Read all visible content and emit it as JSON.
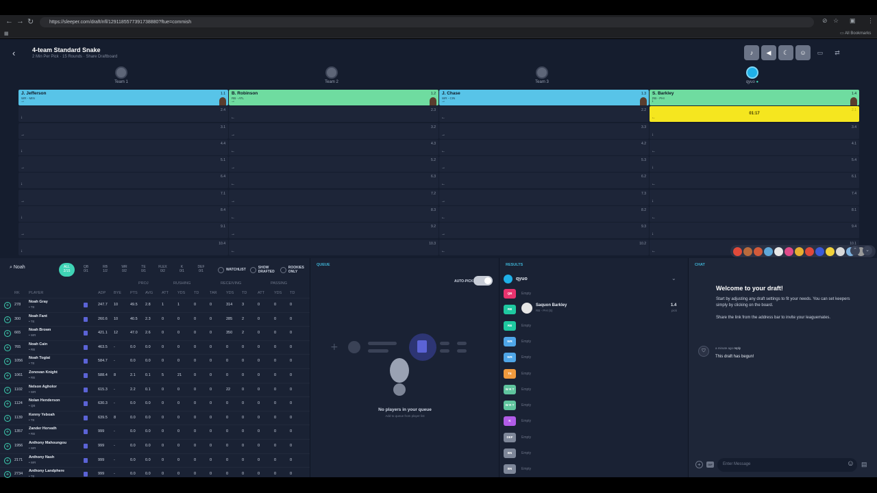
{
  "browser": {
    "url": "https://sleeper.com/draft/nfl/1291185577391738880?ftue=commish",
    "bookmarks_label": "All Bookmarks"
  },
  "header": {
    "title": "4-team Standard Snake",
    "subtitle": "2 Min Per Pick · 15 Rounds · Share Draftboard",
    "buttons": [
      "bell-icon",
      "speaker-icon",
      "moon-icon",
      "smiley-icon",
      "monitor-icon",
      "compress-icon"
    ]
  },
  "teams": [
    "Team 1",
    "Team 2",
    "Team 3",
    "qyuo"
  ],
  "columns": [
    {
      "first": {
        "name": "J. Jefferson",
        "pos": "WR - MIN",
        "pick": "1.1",
        "style": "wr"
      },
      "picks": [
        "2.4",
        "3.1",
        "4.4",
        "5.1",
        "6.4",
        "7.1",
        "8.4",
        "9.1",
        "10.4"
      ],
      "arrows": [
        "↓",
        "→",
        "↓",
        "→",
        "↓",
        "→",
        "↓",
        "→",
        "↓"
      ]
    },
    {
      "first": {
        "name": "B. Robinson",
        "pos": "RB - ATL",
        "pick": "1.2",
        "style": "rb"
      },
      "picks": [
        "2.3",
        "3.2",
        "4.3",
        "5.2",
        "6.3",
        "7.2",
        "8.3",
        "9.2",
        "10.3"
      ],
      "arrows": [
        "←",
        "→",
        "←",
        "→",
        "←",
        "→",
        "←",
        "→",
        "←"
      ]
    },
    {
      "first": {
        "name": "J. Chase",
        "pos": "WR - CIN",
        "pick": "1.3",
        "style": "wr"
      },
      "picks": [
        "2.2",
        "3.3",
        "4.2",
        "5.3",
        "6.2",
        "7.3",
        "8.2",
        "9.3",
        "10.2"
      ],
      "arrows": [
        "←",
        "→",
        "←",
        "→",
        "←",
        "→",
        "←",
        "→",
        "←"
      ]
    },
    {
      "first": {
        "name": "S. Barkley",
        "pos": "RB - PHI",
        "pick": "1.4",
        "style": "rb"
      },
      "clock": {
        "timer": "01:17",
        "pick": "2.1"
      },
      "picks": [
        "3.4",
        "4.1",
        "5.4",
        "6.1",
        "7.4",
        "8.1",
        "9.4",
        "10.1"
      ],
      "arrows": [
        "↓",
        "←",
        "↓",
        "←",
        "↓",
        "←",
        "↓",
        "←"
      ]
    }
  ],
  "players_panel": {
    "search_value": "Noah",
    "position_tabs": [
      {
        "label": "ALL",
        "count": "2/15",
        "active": true
      },
      {
        "label": "QB",
        "count": "0/1"
      },
      {
        "label": "RB",
        "count": "1/2"
      },
      {
        "label": "WR",
        "count": "0/2"
      },
      {
        "label": "TE",
        "count": "0/1"
      },
      {
        "label": "FLEX",
        "count": "0/2"
      },
      {
        "label": "K",
        "count": "0/1"
      },
      {
        "label": "DEF",
        "count": "0/1"
      }
    ],
    "filters": [
      "WATCHLIST",
      "SHOW DRAFTED",
      "ROOKIES ONLY"
    ],
    "group_headers": [
      "PROJ",
      "RUSHING",
      "RECEIVING",
      "PASSING"
    ],
    "columns": [
      "RK",
      "PLAYER",
      "ADP",
      "BYE",
      "PTS",
      "AVG",
      "ATT",
      "YDS",
      "TD",
      "TAR",
      "YDS",
      "TD",
      "ATT",
      "YDS",
      "TD"
    ],
    "rows": [
      {
        "rk": "278",
        "name": "Noah Gray",
        "pos": "• TE",
        "vals": [
          "247.7",
          "10",
          "49.5",
          "2.8",
          "1",
          "1",
          "0",
          "0",
          "314",
          "3",
          "0",
          "0",
          "0"
        ]
      },
      {
        "rk": "300",
        "name": "Noah Fant",
        "pos": "• TE",
        "vals": [
          "260.6",
          "10",
          "40.5",
          "2.3",
          "0",
          "0",
          "0",
          "0",
          "285",
          "2",
          "0",
          "0",
          "0"
        ]
      },
      {
        "rk": "665",
        "name": "Noah Brown",
        "pos": "• WR",
        "vals": [
          "421.1",
          "12",
          "47.0",
          "2.6",
          "0",
          "0",
          "0",
          "0",
          "350",
          "2",
          "0",
          "0",
          "0"
        ]
      },
      {
        "rk": "765",
        "name": "Noah Cain",
        "pos": "• RB",
        "vals": [
          "463.5",
          "-",
          "0.0",
          "0.0",
          "0",
          "0",
          "0",
          "0",
          "0",
          "0",
          "0",
          "0",
          "0"
        ]
      },
      {
        "rk": "1056",
        "name": "Noah Togiai",
        "pos": "• TE",
        "vals": [
          "584.7",
          "-",
          "0.0",
          "0.0",
          "0",
          "0",
          "0",
          "0",
          "0",
          "0",
          "0",
          "0",
          "0"
        ]
      },
      {
        "rk": "1061",
        "name": "Zonovan Knight",
        "pos": "• RB",
        "vals": [
          "588.4",
          "8",
          "2.1",
          "0.1",
          "5",
          "21",
          "0",
          "0",
          "0",
          "0",
          "0",
          "0",
          "0"
        ]
      },
      {
        "rk": "1102",
        "name": "Nelson Agholor",
        "pos": "• WR",
        "vals": [
          "615.3",
          "-",
          "2.2",
          "0.1",
          "0",
          "0",
          "0",
          "0",
          "22",
          "0",
          "0",
          "0",
          "0"
        ]
      },
      {
        "rk": "1124",
        "name": "Nolan Henderson",
        "pos": "• QB",
        "vals": [
          "630.3",
          "-",
          "0.0",
          "0.0",
          "0",
          "0",
          "0",
          "0",
          "0",
          "0",
          "0",
          "0",
          "0"
        ]
      },
      {
        "rk": "1139",
        "name": "Kenny Yeboah",
        "pos": "• TE",
        "vals": [
          "639.5",
          "8",
          "0.0",
          "0.0",
          "0",
          "0",
          "0",
          "0",
          "0",
          "0",
          "0",
          "0",
          "0"
        ]
      },
      {
        "rk": "1357",
        "name": "Zander Horvath",
        "pos": "• RB",
        "vals": [
          "999",
          "-",
          "0.0",
          "0.0",
          "0",
          "0",
          "0",
          "0",
          "0",
          "0",
          "0",
          "0",
          "0"
        ]
      },
      {
        "rk": "1956",
        "name": "Anthony Mahoungou",
        "pos": "• WR",
        "vals": [
          "999",
          "-",
          "0.0",
          "0.0",
          "0",
          "0",
          "0",
          "0",
          "0",
          "0",
          "0",
          "0",
          "0"
        ]
      },
      {
        "rk": "2171",
        "name": "Anthony Nash",
        "pos": "• WR",
        "vals": [
          "999",
          "-",
          "0.0",
          "0.0",
          "0",
          "0",
          "0",
          "0",
          "0",
          "0",
          "0",
          "0",
          "0"
        ]
      },
      {
        "rk": "2734",
        "name": "Anthony Landphere",
        "pos": "• TE",
        "vals": [
          "999",
          "-",
          "0.0",
          "0.0",
          "0",
          "0",
          "0",
          "0",
          "0",
          "0",
          "0",
          "0",
          "0"
        ]
      }
    ]
  },
  "queue": {
    "title": "QUEUE",
    "auto_pick_label": "AUTO-PICK",
    "empty_title": "No players in your queue",
    "empty_sub": "Add to queue from player list"
  },
  "results": {
    "title": "RESULTS",
    "user": "qyuo",
    "slots": [
      {
        "pos": "QB",
        "color": "#e8336e",
        "label": "Empty"
      },
      {
        "pos": "RB",
        "color": "#1fc9a0",
        "player": "Saquon Barkley",
        "sub": "RB - PHI (5)",
        "pick": "1.4",
        "pick_label": "pick"
      },
      {
        "pos": "RB",
        "color": "#1fc9a0",
        "label": "Empty"
      },
      {
        "pos": "WR",
        "color": "#4fa6e8",
        "label": "Empty"
      },
      {
        "pos": "WR",
        "color": "#4fa6e8",
        "label": "Empty"
      },
      {
        "pos": "TE",
        "color": "#f09a3e",
        "label": "Empty"
      },
      {
        "pos": "W R T",
        "color": "#5fc49e",
        "label": "Empty"
      },
      {
        "pos": "W R T",
        "color": "#5fc49e",
        "label": "Empty"
      },
      {
        "pos": "K",
        "color": "#b15ce8",
        "label": "Empty"
      },
      {
        "pos": "DEF",
        "color": "#7e8799",
        "label": "Empty"
      },
      {
        "pos": "BN",
        "color": "#7e8799",
        "label": "Empty"
      },
      {
        "pos": "BN",
        "color": "#7e8799",
        "label": "Empty"
      }
    ]
  },
  "chat": {
    "title": "CHAT",
    "welcome_title": "Welcome to your draft!",
    "welcome_p1": "Start by adjusting any draft settings to fit your needs. You can set keepers simply by clicking on the board.",
    "welcome_p2": "Share the link from the address bar to invite your leaguemates.",
    "msg_time": "a minute ago",
    "msg_reply": "reply",
    "msg_text": "This draft has begun!",
    "input_placeholder": "Enter Message",
    "gif_label": "GIF"
  }
}
